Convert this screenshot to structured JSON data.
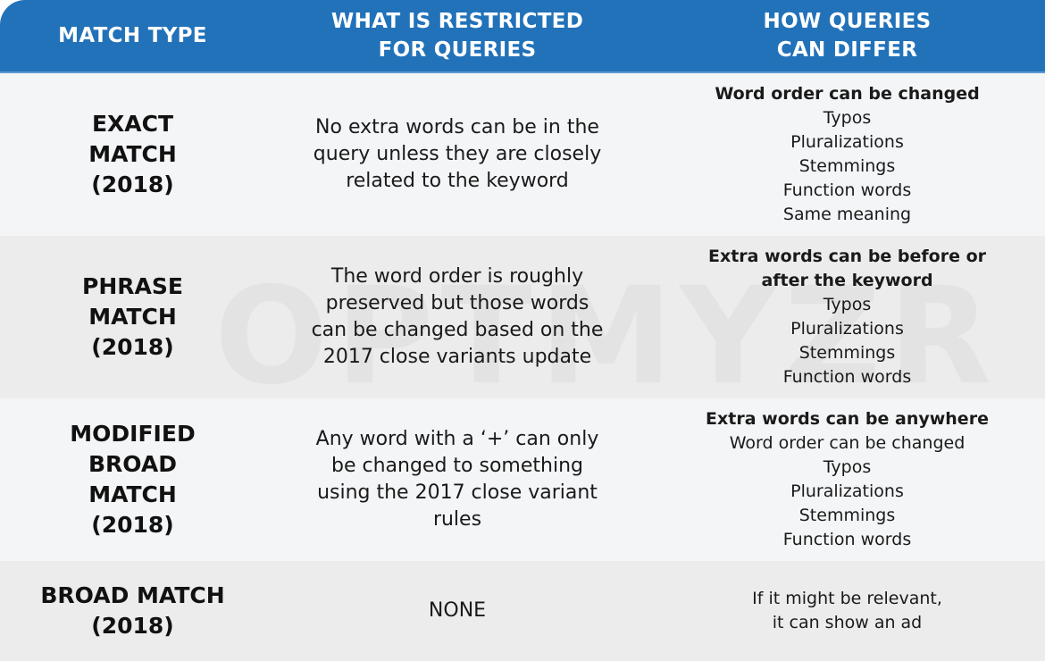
{
  "header": {
    "columns": [
      "MATCH TYPE",
      "WHAT IS RESTRICTED\nFOR QUERIES",
      "HOW QUERIES\nCAN DIFFER"
    ]
  },
  "colors": {
    "header": "#2272b9",
    "row_light": "#f4f5f7",
    "row_dark": "#ececec"
  },
  "watermark": "OPTMYZR",
  "rows": [
    {
      "match_type": [
        "EXACT",
        "MATCH",
        "(2018)"
      ],
      "restricted": [
        "No extra words can be in the",
        "query unless they are closely",
        "related to the keyword"
      ],
      "differ_bold": [
        "Word order can be changed"
      ],
      "differ": [
        "Typos",
        "Pluralizations",
        "Stemmings",
        "Function words",
        "Same meaning"
      ]
    },
    {
      "match_type": [
        "PHRASE",
        "MATCH",
        "(2018)"
      ],
      "restricted": [
        "The word order is roughly",
        "preserved but those words",
        "can be changed based on the",
        "2017 close variants update"
      ],
      "differ_bold": [
        "Extra words can be before or",
        "after the keyword"
      ],
      "differ": [
        "Typos",
        "Pluralizations",
        "Stemmings",
        "Function words"
      ]
    },
    {
      "match_type": [
        "MODIFIED",
        "BROAD",
        "MATCH",
        "(2018)"
      ],
      "restricted": [
        "Any word with a ‘+’ can only",
        "be changed to something",
        "using the 2017 close variant",
        "rules"
      ],
      "differ_bold": [
        "Extra words can be anywhere"
      ],
      "differ": [
        "Word order can be changed",
        "Typos",
        "Pluralizations",
        "Stemmings",
        "Function words"
      ]
    },
    {
      "match_type": [
        "BROAD MATCH",
        "(2018)"
      ],
      "restricted": [
        "NONE"
      ],
      "differ_bold": [],
      "differ": [
        "If it might be relevant,",
        "it can show an ad"
      ]
    }
  ]
}
